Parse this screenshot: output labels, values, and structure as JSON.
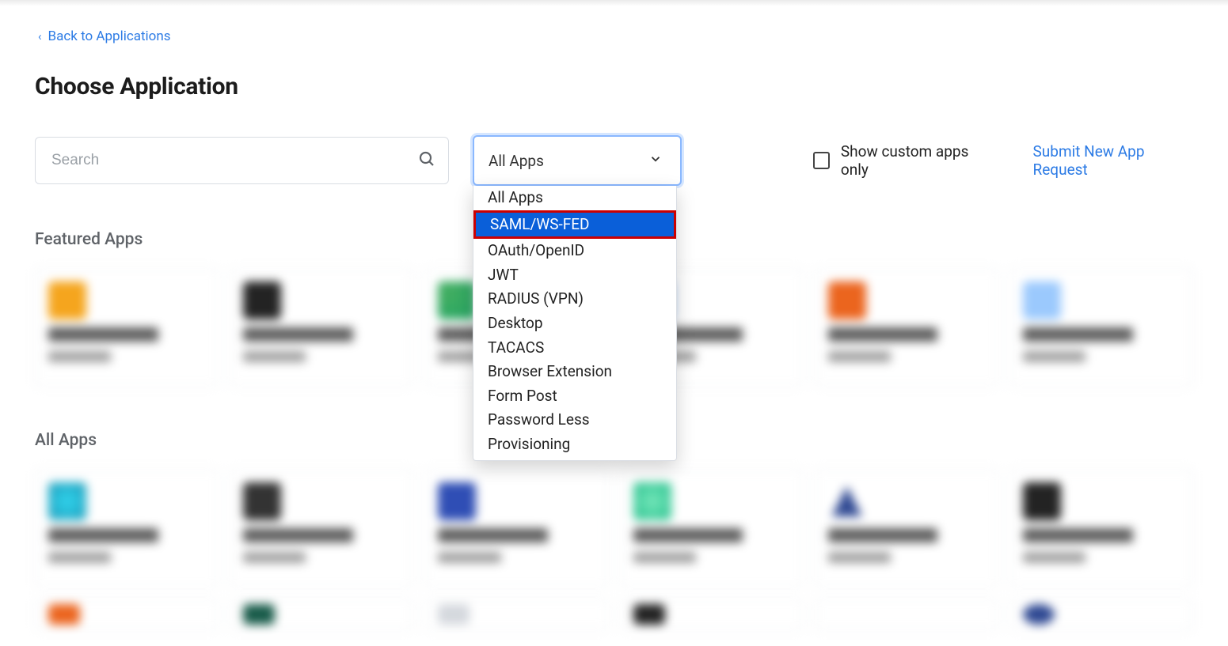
{
  "back_link": {
    "label": "Back to Applications"
  },
  "page_title": "Choose Application",
  "search": {
    "placeholder": "Search"
  },
  "filter": {
    "selected": "All Apps",
    "options": [
      "All Apps",
      "SAML/WS-FED",
      "OAuth/OpenID",
      "JWT",
      "RADIUS (VPN)",
      "Desktop",
      "TACACS",
      "Browser Extension",
      "Form Post",
      "Password Less",
      "Provisioning"
    ],
    "highlighted_index": 1
  },
  "custom_only": {
    "label": "Show custom apps only",
    "checked": false
  },
  "submit_link": {
    "label": "Submit New App Request"
  },
  "sections": {
    "featured": {
      "title": "Featured Apps"
    },
    "all": {
      "title": "All Apps"
    }
  }
}
